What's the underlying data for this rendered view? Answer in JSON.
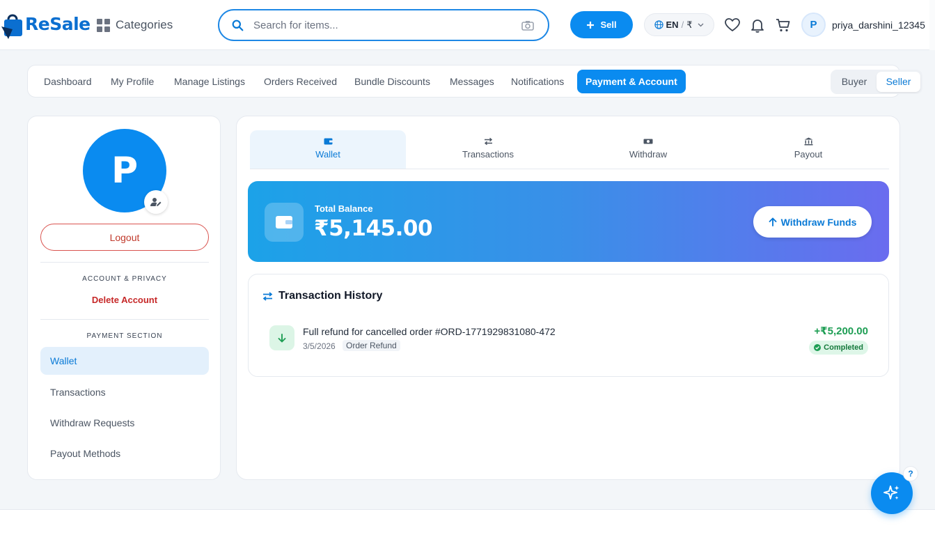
{
  "header": {
    "logo_text": "ReSale",
    "categories_label": "Categories",
    "search_placeholder": "Search for items...",
    "sell_label": "Sell",
    "language": "EN",
    "currency": "₹",
    "username": "priya_darshini_12345",
    "avatar_letter": "P",
    "icons": [
      "search-icon",
      "camera-icon",
      "globe-icon",
      "heart-icon",
      "bell-icon",
      "cart-icon"
    ]
  },
  "nav": {
    "tabs": [
      {
        "label": "Dashboard"
      },
      {
        "label": "My Profile"
      },
      {
        "label": "Manage Listings"
      },
      {
        "label": "Orders Received"
      },
      {
        "label": "Bundle Discounts"
      },
      {
        "label": "Messages"
      },
      {
        "label": "Notifications"
      },
      {
        "label": "Payment & Account",
        "active": true
      }
    ],
    "role_toggle": {
      "options": [
        "Buyer",
        "Seller"
      ],
      "selected": "Seller"
    }
  },
  "sidebar": {
    "avatar_letter": "P",
    "logout_label": "Logout",
    "account_section_title": "ACCOUNT & PRIVACY",
    "delete_account_label": "Delete Account",
    "payment_section_title": "PAYMENT SECTION",
    "items": [
      {
        "label": "Wallet",
        "active": true
      },
      {
        "label": "Transactions"
      },
      {
        "label": "Withdraw Requests"
      },
      {
        "label": "Payout Methods"
      }
    ]
  },
  "main": {
    "tabs": [
      {
        "label": "Wallet",
        "icon": "wallet-icon",
        "active": true
      },
      {
        "label": "Transactions",
        "icon": "transfer-icon"
      },
      {
        "label": "Withdraw",
        "icon": "cash-icon"
      },
      {
        "label": "Payout",
        "icon": "bank-icon"
      }
    ],
    "balance": {
      "label": "Total Balance",
      "amount": "₹5,145.00",
      "withdraw_label": "Withdraw Funds"
    },
    "history": {
      "title": "Transaction History",
      "transactions": [
        {
          "description": "Full refund for cancelled order #ORD-1771929831080-472",
          "date": "3/5/2026",
          "type": "Order Refund",
          "amount": "+₹5,200.00",
          "status": "Completed"
        }
      ]
    }
  },
  "floating": {
    "help_label": "?"
  },
  "colors": {
    "accent": "#0a8bf0",
    "success": "#1e9e54",
    "danger": "#c62828",
    "gradient_start": "#1ca2e8",
    "gradient_end": "#6a6cef"
  }
}
